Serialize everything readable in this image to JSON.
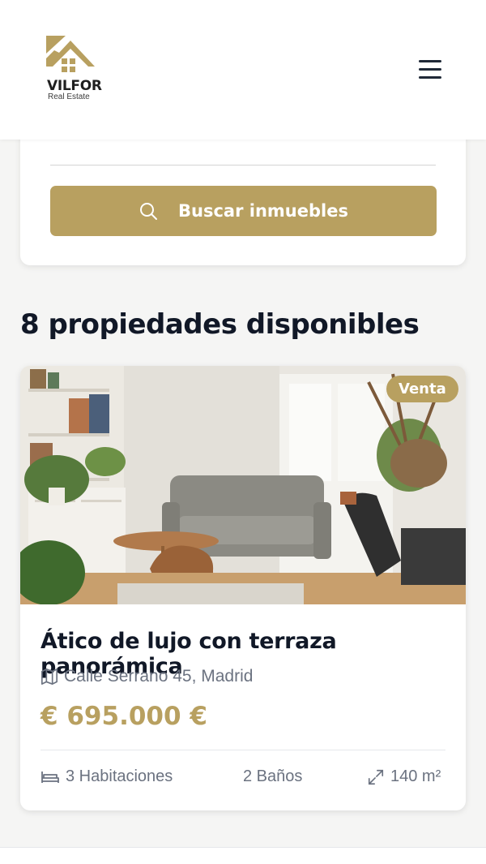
{
  "brand": {
    "name": "VILFOR",
    "tagline": "Real Estate",
    "accent_color": "#b8a060"
  },
  "header": {
    "menu_icon": "hamburger-menu-icon"
  },
  "search": {
    "button_label": "Buscar inmuebles",
    "button_icon": "search-icon"
  },
  "results": {
    "title": "8 propiedades disponibles"
  },
  "listings": [
    {
      "badge": "Venta",
      "title": "Ático de lujo con terraza panorámica",
      "address": "Calle Serrano 45, Madrid",
      "price": "€ 695.000 €",
      "features": {
        "rooms": "3 Habitaciones",
        "baths": "2 Baños",
        "area": "140 m²"
      }
    }
  ]
}
